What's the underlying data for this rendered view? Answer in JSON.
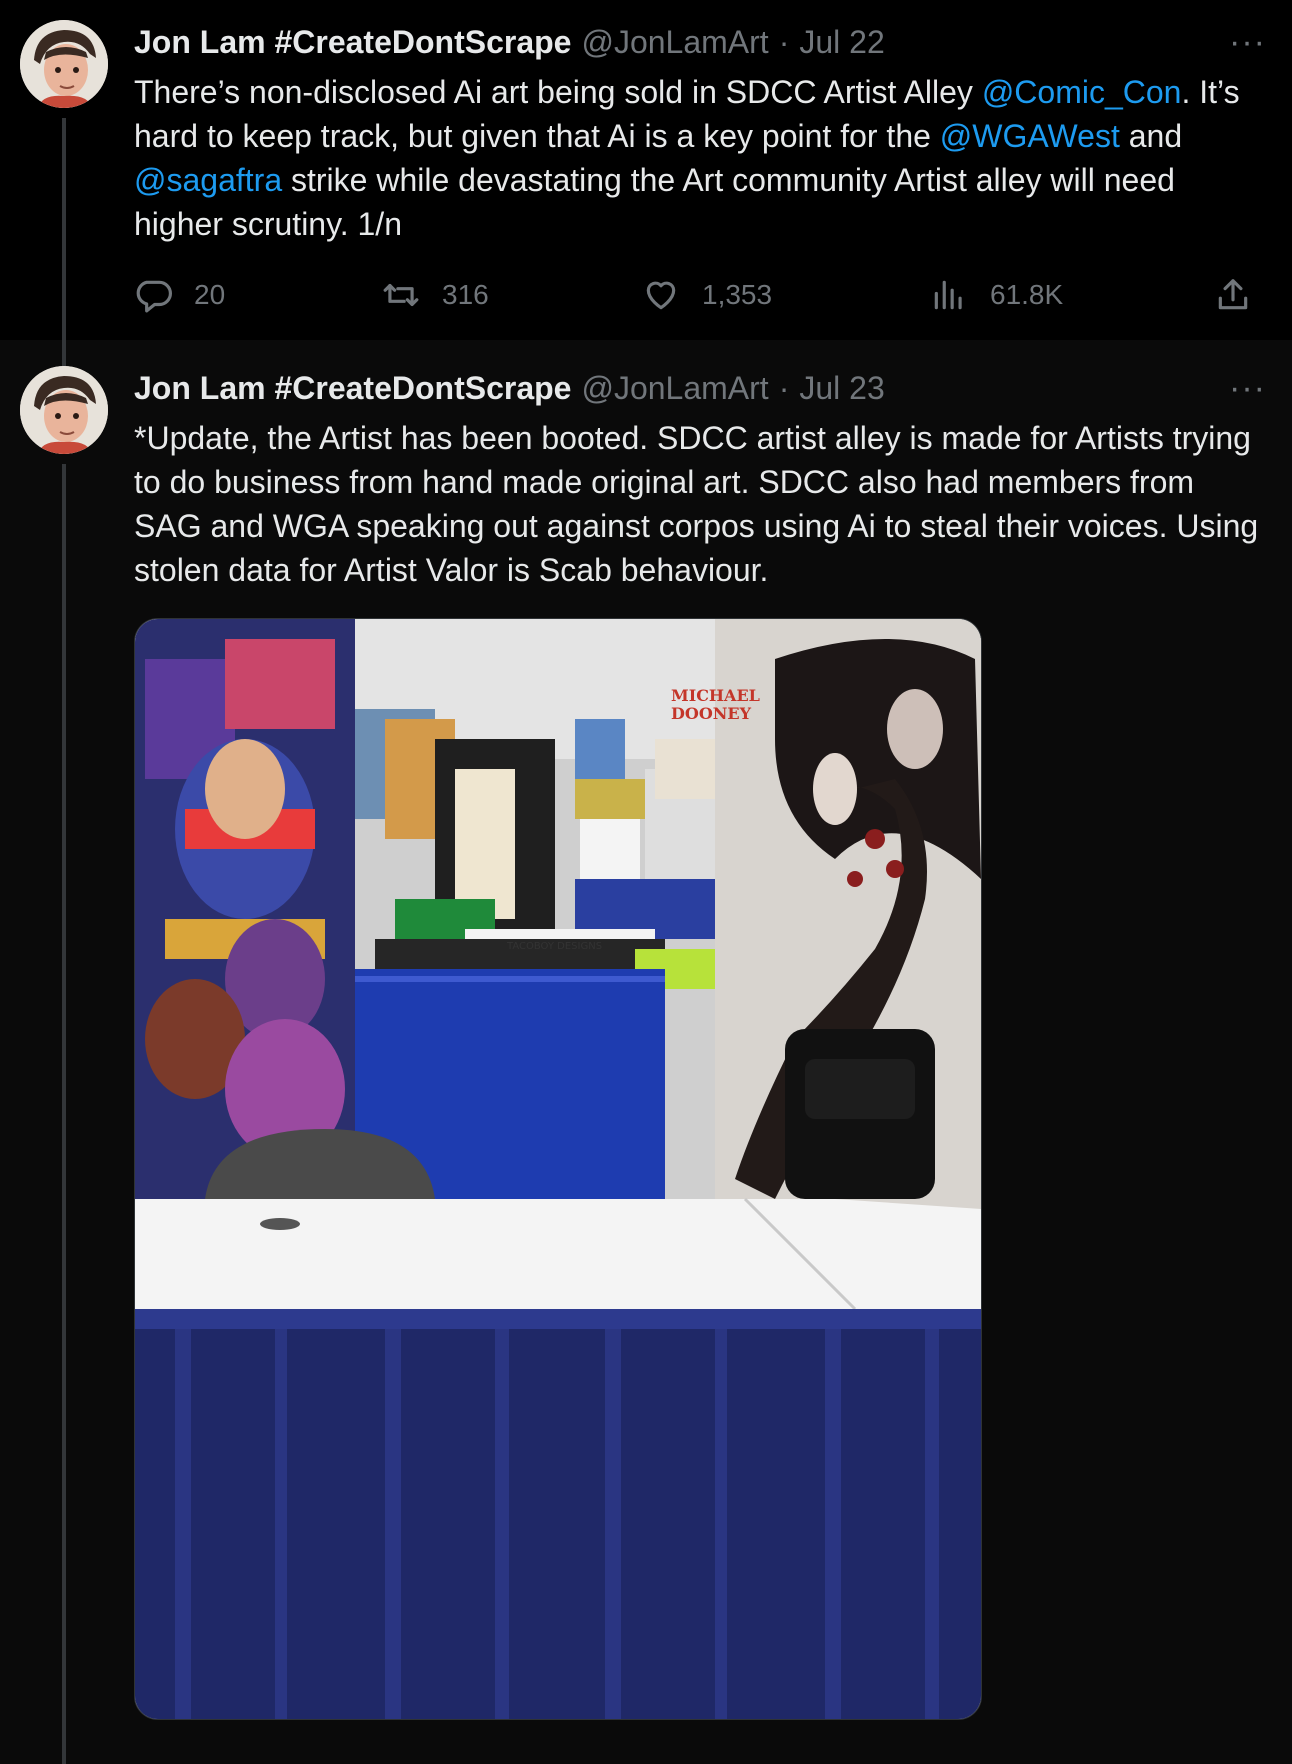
{
  "tweets": [
    {
      "name": "Jon Lam #CreateDontScrape",
      "handle": "@JonLamArt",
      "sep": "·",
      "date": "Jul 22",
      "more": "···",
      "text_1": "There’s  non-disclosed Ai art being sold in SDCC Artist Alley ",
      "mention_1": "@Comic_Con",
      "text_2": ". It’s hard to keep track, but given that Ai is a key point for the ",
      "mention_2": "@WGAWest",
      "text_3": " and ",
      "mention_3": "@sagaftra",
      "text_4": " strike while devastating the Art community Artist alley will need higher scrutiny. 1/n",
      "stats": {
        "replies": "20",
        "reposts": "316",
        "likes": "1,353",
        "views": "61.8K"
      }
    },
    {
      "name": "Jon Lam #CreateDontScrape",
      "handle": "@JonLamArt",
      "sep": "·",
      "date": "Jul 23",
      "more": "···",
      "text": "*Update, the Artist has been booted. SDCC artist alley is made for Artists trying to do business from hand made original art. SDCC also had members from SAG and WGA speaking out against corpos using Ai to steal their voices. Using stolen data for Artist Valor is Scab behaviour.",
      "photo": {
        "banner_text_1": "MICHAEL",
        "banner_text_2": "DOONEY",
        "sign_text": "TACOBOY DESIGNS"
      }
    }
  ],
  "colors": {
    "background": "#000000",
    "background_alt": "#0a0a0a",
    "text": "#e7e9ea",
    "secondary": "#71767b",
    "link": "#1d9bf0",
    "thread_line": "#333639"
  },
  "icons": [
    "reply-icon",
    "repost-icon",
    "like-icon",
    "views-icon",
    "share-icon",
    "more-icon"
  ]
}
